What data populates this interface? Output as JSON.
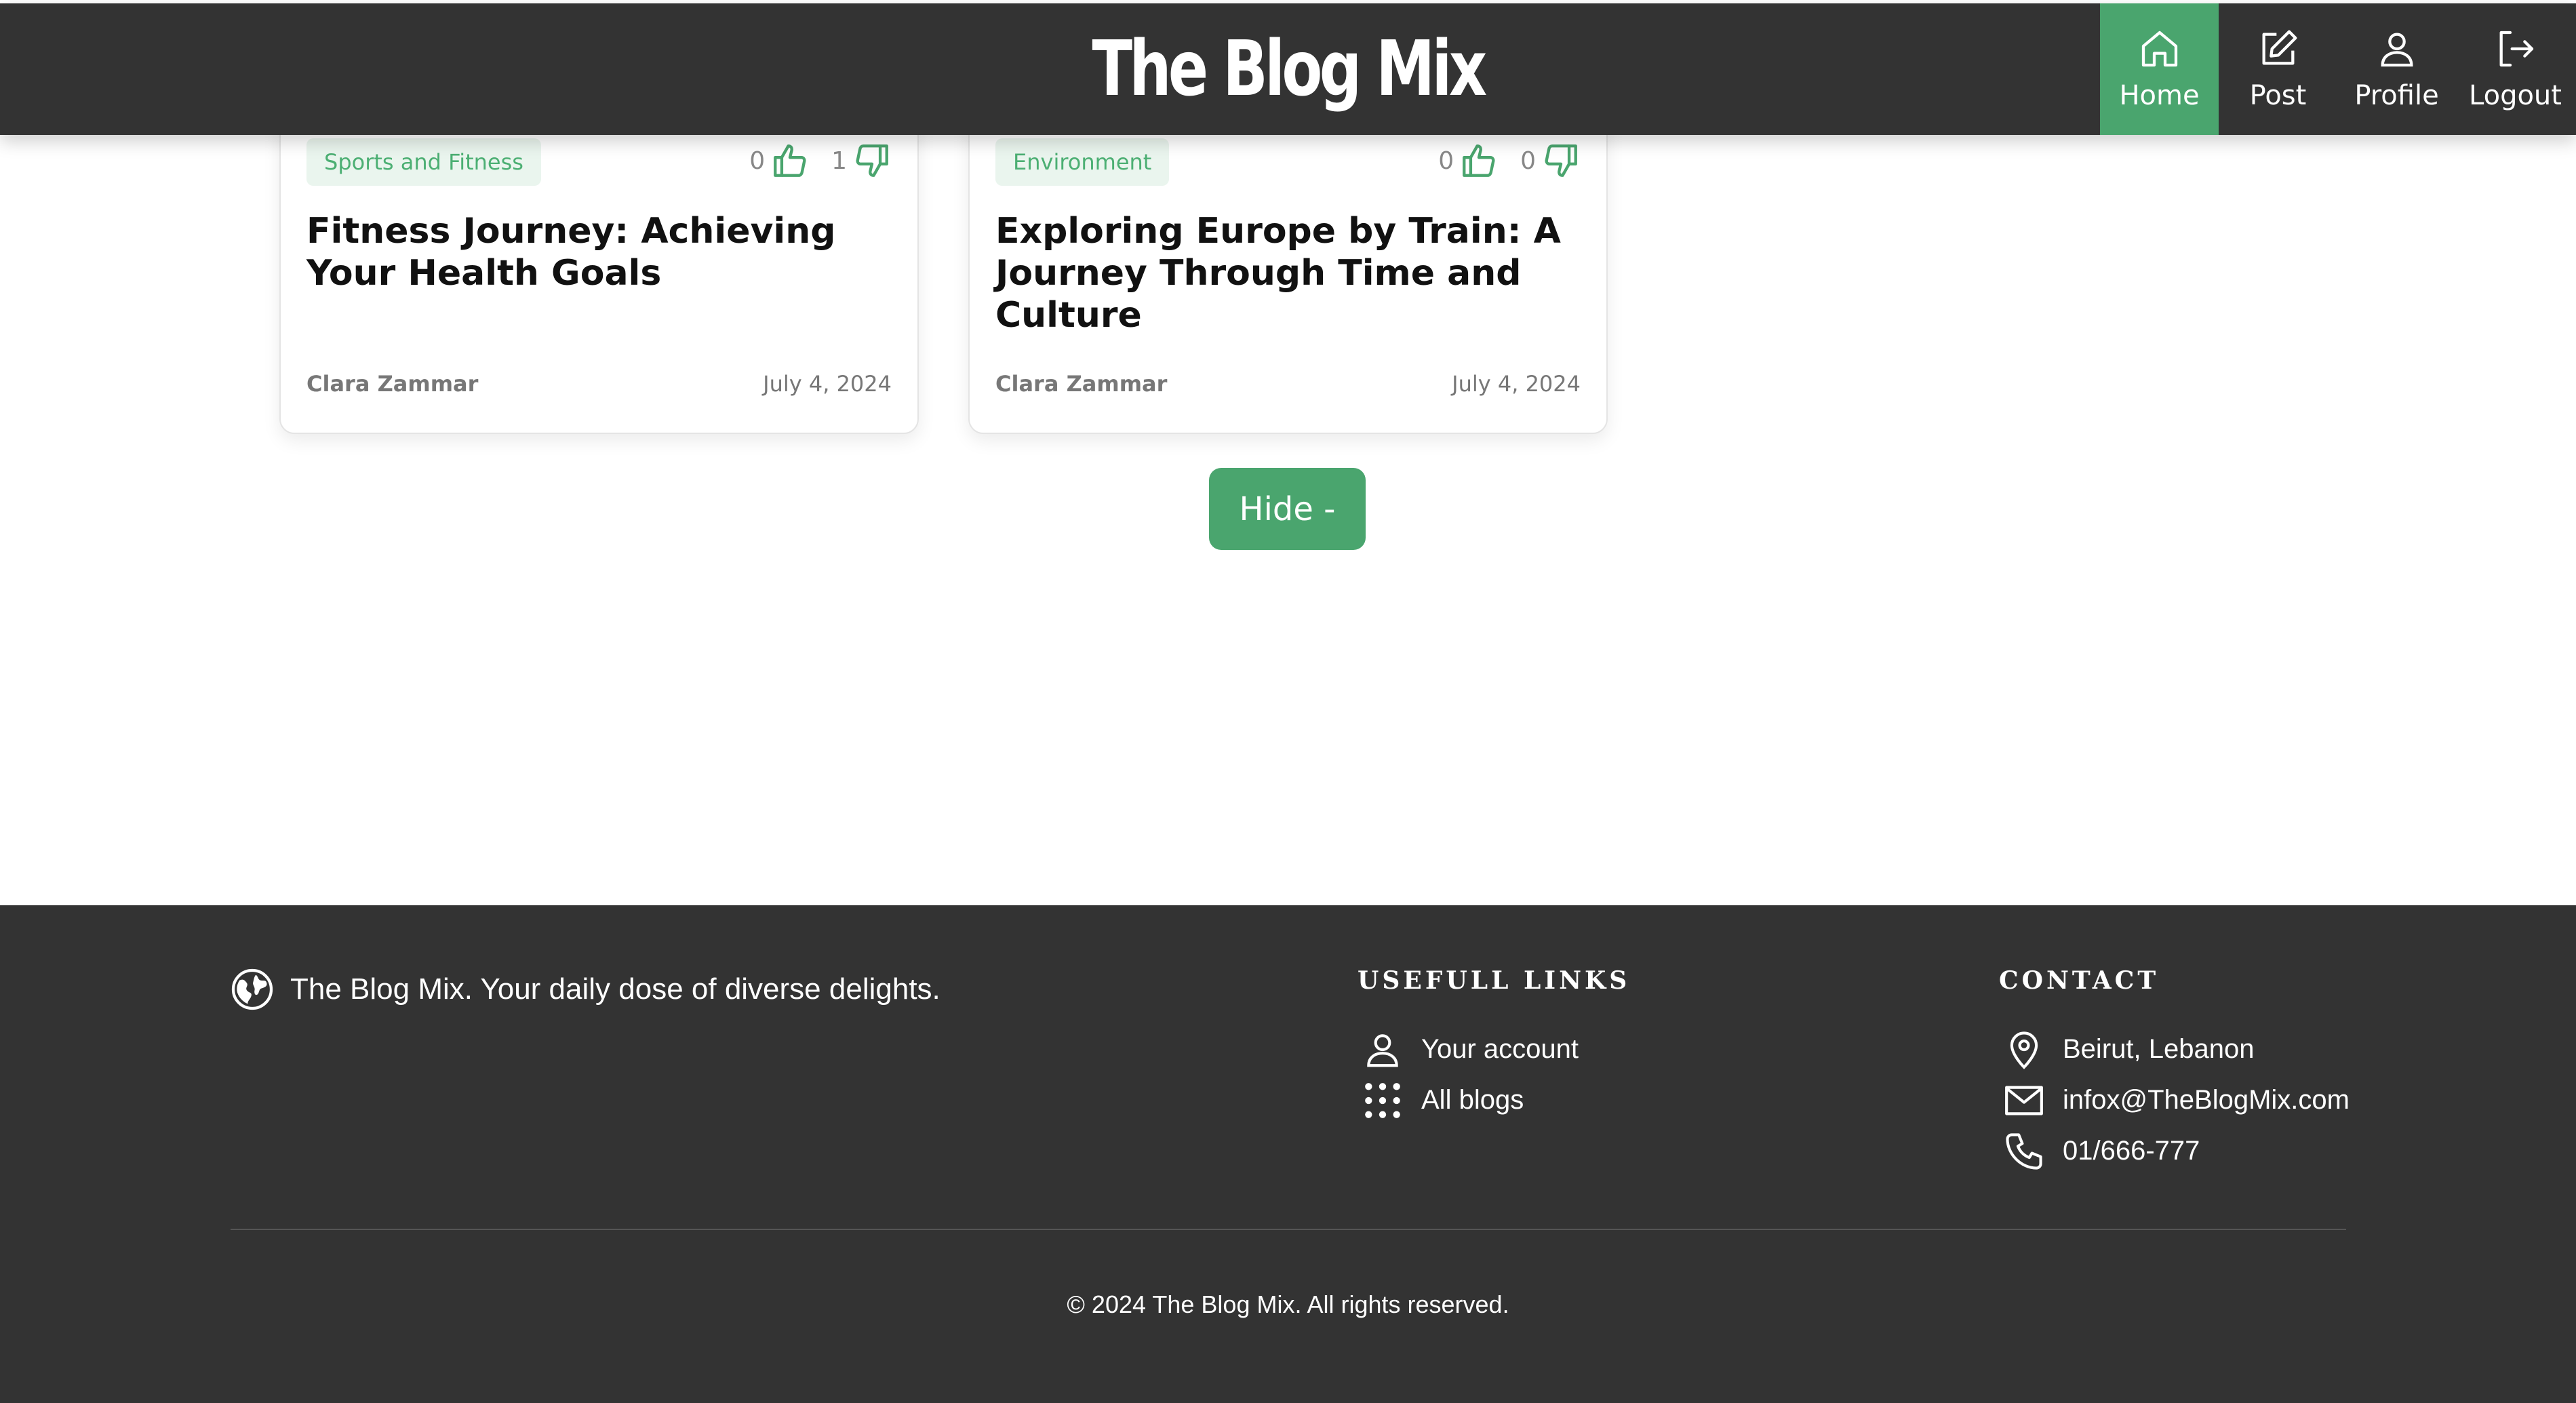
{
  "header": {
    "brand": "The Blog Mix",
    "nav": [
      {
        "label": "Home",
        "icon": "home-icon",
        "active": true
      },
      {
        "label": "Post",
        "icon": "edit-icon"
      },
      {
        "label": "Profile",
        "icon": "user-icon"
      },
      {
        "label": "Logout",
        "icon": "logout-icon"
      }
    ]
  },
  "cards": [
    {
      "category": "Sports and Fitness",
      "likes": "0",
      "dislikes": "1",
      "title": "Fitness Journey: Achieving Your Health Goals",
      "author": "Clara Zammar",
      "date": "July 4, 2024"
    },
    {
      "category": "Environment",
      "likes": "0",
      "dislikes": "0",
      "title": "Exploring Europe by Train: A Journey Through Time and Culture",
      "author": "Clara Zammar",
      "date": "July 4, 2024"
    }
  ],
  "hide_button": "Hide -",
  "footer": {
    "tagline": "The Blog Mix. Your daily dose of diverse delights.",
    "links_heading": "USEFULL LINKS",
    "links": [
      {
        "label": "Your account",
        "icon": "user-icon"
      },
      {
        "label": "All blogs",
        "icon": "grid-icon"
      }
    ],
    "contact_heading": "CONTACT",
    "contact": [
      {
        "label": "Beirut, Lebanon",
        "icon": "location-icon"
      },
      {
        "label": "infox@TheBlogMix.com",
        "icon": "mail-icon"
      },
      {
        "label": "01/666-777",
        "icon": "phone-icon"
      }
    ],
    "copyright": "© 2024 The Blog Mix. All rights reserved."
  },
  "colors": {
    "accent": "#4aa56e",
    "dark": "#333333",
    "tag_bg": "#eaf5ee"
  }
}
